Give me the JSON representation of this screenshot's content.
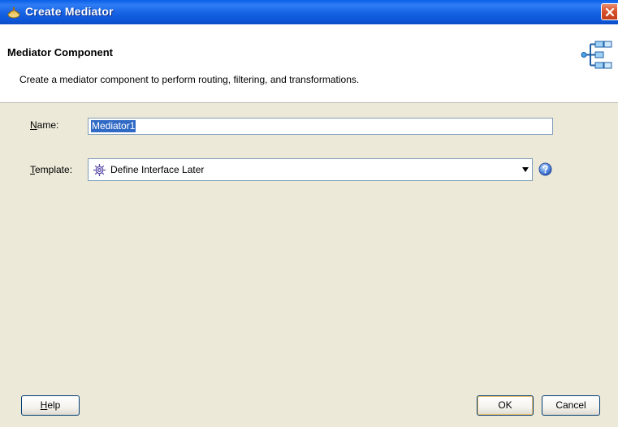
{
  "window": {
    "title": "Create Mediator"
  },
  "header": {
    "title": "Mediator Component",
    "description": "Create a mediator component to perform routing, filtering, and transformations.",
    "logo_icon": "mediator-routing-icon"
  },
  "form": {
    "name_label_mnemonic": "N",
    "name_label_rest": "ame:",
    "name_value": "Mediator1",
    "template_label_mnemonic": "T",
    "template_label_rest": "emplate:",
    "template_value": "Define Interface Later",
    "template_icon": "gear-icon"
  },
  "buttons": {
    "help_mnemonic": "H",
    "help_rest": "elp",
    "ok": "OK",
    "cancel": "Cancel"
  },
  "colors": {
    "titlebar": "#0a5fe6",
    "selection": "#316ac5",
    "dialog_bg": "#ece9d8"
  }
}
